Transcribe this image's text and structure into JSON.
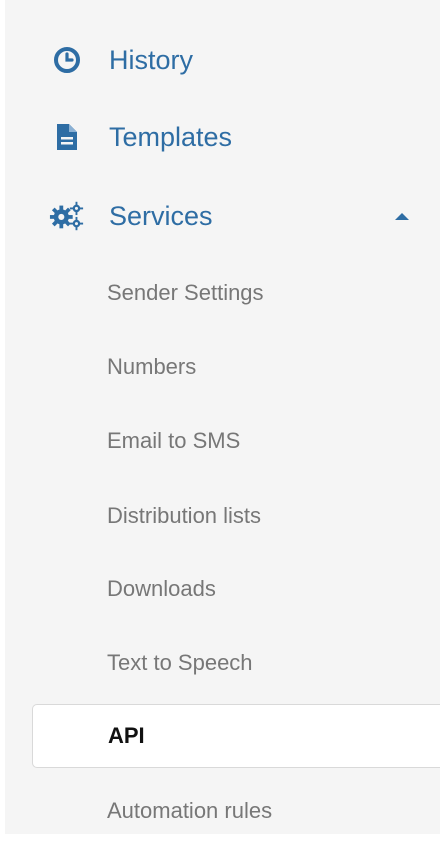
{
  "nav": {
    "history": {
      "label": "History",
      "icon": "clock-icon"
    },
    "templates": {
      "label": "Templates",
      "icon": "file-icon"
    },
    "services": {
      "label": "Services",
      "icon": "gears-icon",
      "caret": "caret-up-icon"
    }
  },
  "services_submenu": {
    "sender_settings": "Sender Settings",
    "numbers": "Numbers",
    "email_to_sms": "Email to SMS",
    "distribution_lists": "Distribution lists",
    "downloads": "Downloads",
    "text_to_speech": "Text to Speech",
    "api": "API",
    "automation_rules": "Automation rules"
  },
  "colors": {
    "link": "#2e6da4",
    "submenu_text": "#777777",
    "active_text": "#111111",
    "sidebar_bg": "#f5f5f5",
    "active_bg": "#ffffff"
  },
  "active_item": "API"
}
